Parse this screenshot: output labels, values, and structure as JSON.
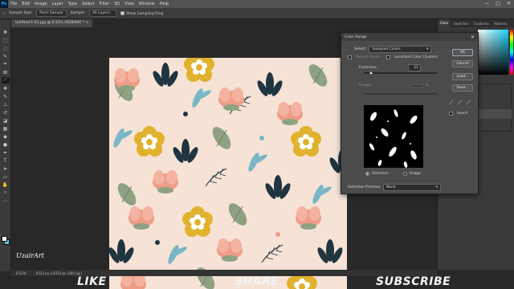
{
  "menubar": {
    "logo": "Ps",
    "items": [
      "File",
      "Edit",
      "Image",
      "Layer",
      "Type",
      "Select",
      "Filter",
      "3D",
      "View",
      "Window",
      "Help"
    ],
    "window_controls": [
      "—",
      "□",
      "✕"
    ]
  },
  "options": {
    "sample_size_label": "Sample Size:",
    "sample_size_value": "Point Sample",
    "sample_label": "Sample:",
    "sample_value": "All Layers",
    "show_ring_label": "Show Sampling Ring"
  },
  "document": {
    "tab_title": "Untitled-1-01.jpg @ 8.52% (RGB/8#) *",
    "close": "×"
  },
  "status": {
    "zoom": "8.52%",
    "doc_info": "8333 px x 8333 px (300 ppi)"
  },
  "panels": {
    "tabs": [
      "Color",
      "Swatches",
      "Gradients",
      "Patterns"
    ],
    "active_tab": "Color"
  },
  "dialog": {
    "title": "Color Range",
    "close": "✕",
    "select_label": "Select:",
    "select_value": "Sampled Colors",
    "detect_faces_label": "Detect Faces",
    "localized_label": "Localized Color Clusters",
    "fuzziness_label": "Fuzziness:",
    "fuzziness_value": "21",
    "range_label": "Range:",
    "range_unit": "%",
    "selection_label": "Selection",
    "image_label": "Image",
    "preview_label": "Selection Preview:",
    "preview_value": "None",
    "ok_label": "OK",
    "cancel_label": "Cancel",
    "load_label": "Load...",
    "save_label": "Save...",
    "invert_label": "Invert",
    "fuzziness_level": 0.1
  },
  "overlay": {
    "signature": "UzairArt",
    "like": "LIKE",
    "share": "SHARE",
    "subscribe": "SUBSCRIBE"
  },
  "colors": {
    "pattern_bg": "#f6e3d6",
    "flower_yellow": "#e0b22d",
    "flower_pink": "#ee9c86",
    "leaf_navy": "#1f3540",
    "leaf_blue": "#7ab6c6",
    "leaf_sage": "#8ea282"
  }
}
